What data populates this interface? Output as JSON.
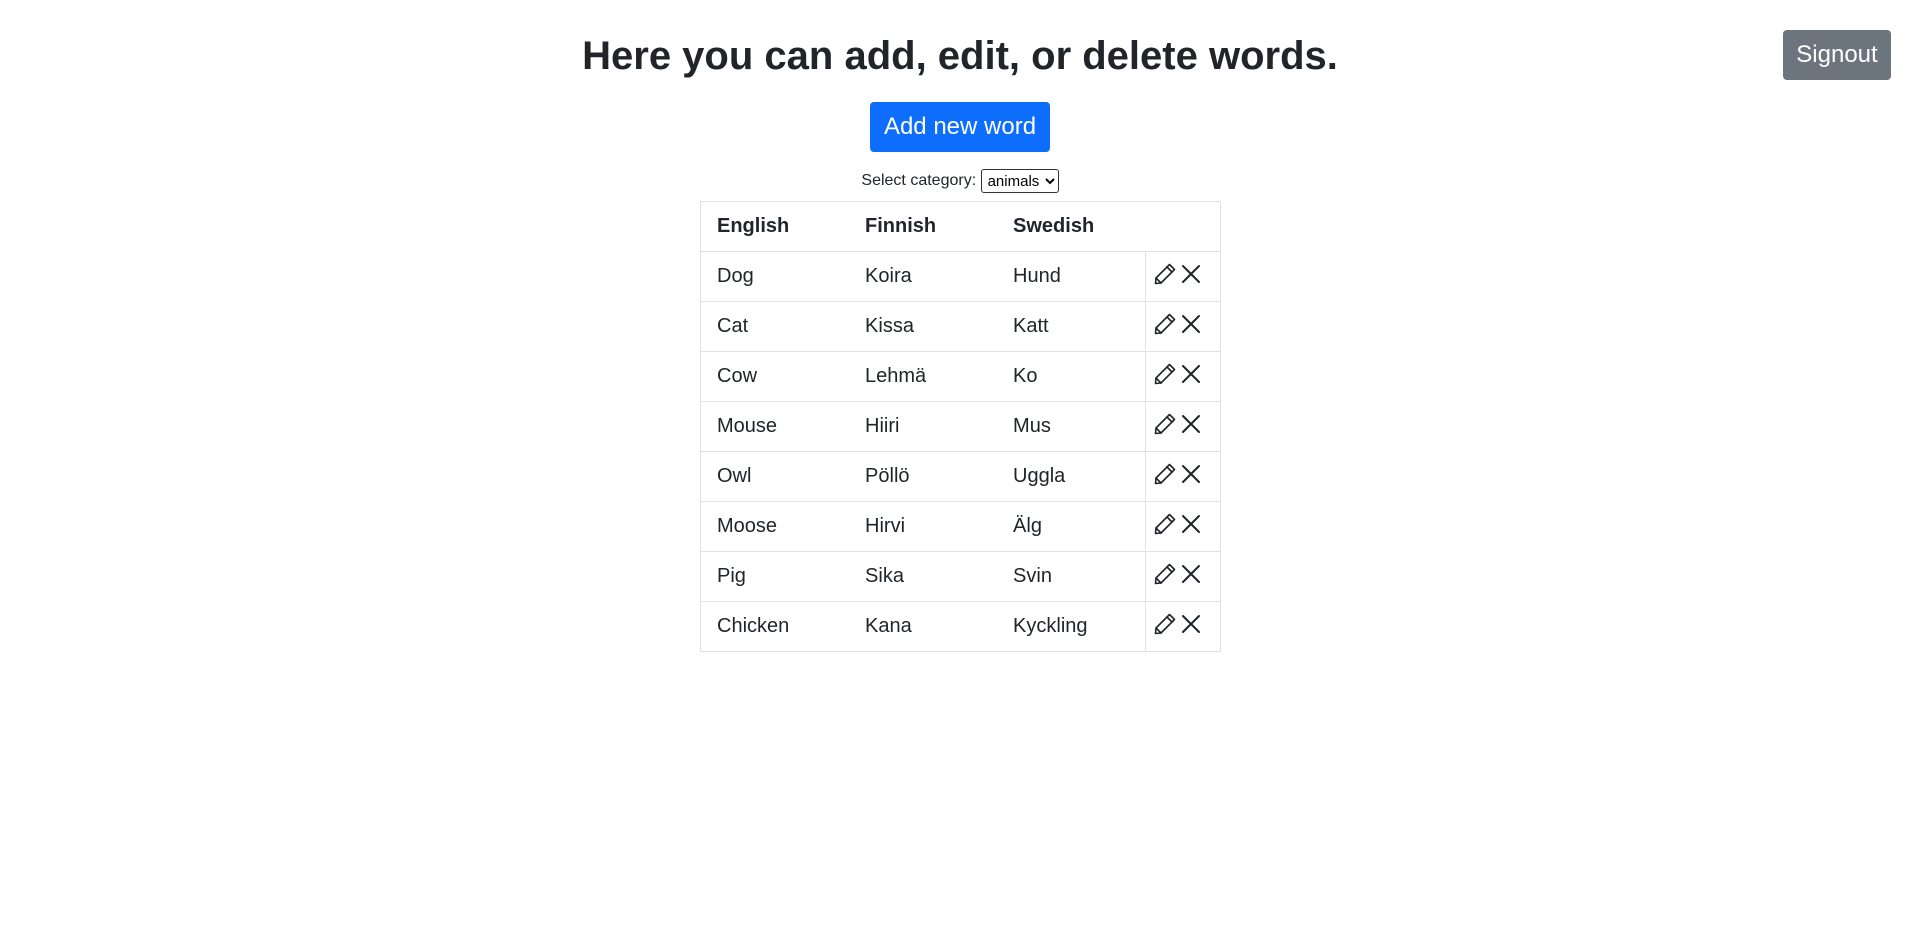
{
  "header": {
    "title": "Here you can add, edit, or delete words.",
    "signout_label": "Signout"
  },
  "actions": {
    "add_label": "Add new word"
  },
  "category": {
    "label": "Select category:",
    "selected": "animals"
  },
  "table": {
    "headers": [
      "English",
      "Finnish",
      "Swedish"
    ],
    "rows": [
      {
        "english": "Dog",
        "finnish": "Koira",
        "swedish": "Hund"
      },
      {
        "english": "Cat",
        "finnish": "Kissa",
        "swedish": "Katt"
      },
      {
        "english": "Cow",
        "finnish": "Lehmä",
        "swedish": "Ko"
      },
      {
        "english": "Mouse",
        "finnish": "Hiiri",
        "swedish": "Mus"
      },
      {
        "english": "Owl",
        "finnish": "Pöllö",
        "swedish": "Uggla"
      },
      {
        "english": "Moose",
        "finnish": "Hirvi",
        "swedish": "Älg"
      },
      {
        "english": "Pig",
        "finnish": "Sika",
        "swedish": "Svin"
      },
      {
        "english": "Chicken",
        "finnish": "Kana",
        "swedish": "Kyckling"
      }
    ],
    "row_icons": [
      "pencil-icon",
      "close-icon"
    ]
  },
  "colors": {
    "primary": "#0d6efd",
    "secondary": "#6c757d",
    "text": "#212529",
    "border": "#dee2e6"
  }
}
